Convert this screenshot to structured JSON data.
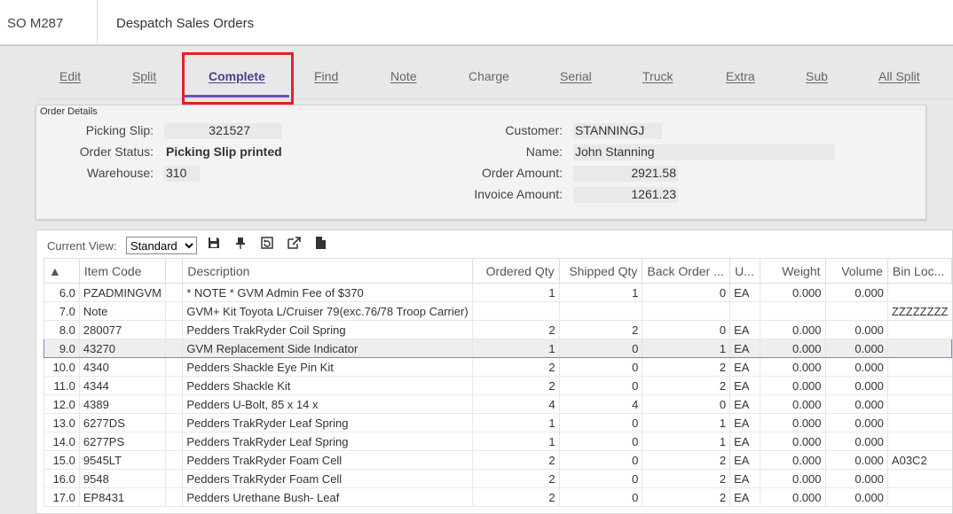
{
  "header": {
    "code": "SO M287",
    "title": "Despatch Sales Orders"
  },
  "tabs": [
    {
      "label": "Edit",
      "name": "tab-edit"
    },
    {
      "label": "Split",
      "name": "tab-split"
    },
    {
      "label": "Complete",
      "name": "tab-complete",
      "active": true
    },
    {
      "label": "Find",
      "name": "tab-find"
    },
    {
      "label": "Note",
      "name": "tab-note"
    },
    {
      "label": "Charge",
      "name": "tab-charge"
    },
    {
      "label": "Serial",
      "name": "tab-serial"
    },
    {
      "label": "Truck",
      "name": "tab-truck"
    },
    {
      "label": "Extra",
      "name": "tab-extra"
    },
    {
      "label": "Sub",
      "name": "tab-sub"
    },
    {
      "label": "All Split",
      "name": "tab-all-split"
    }
  ],
  "details": {
    "legend": "Order Details",
    "picking_slip_label": "Picking Slip:",
    "picking_slip": "321527",
    "order_status_label": "Order Status:",
    "order_status": "Picking Slip printed",
    "warehouse_label": "Warehouse:",
    "warehouse": "310",
    "customer_label": "Customer:",
    "customer": "STANNINGJ",
    "name_label": "Name:",
    "name": "John Stanning",
    "order_amount_label": "Order Amount:",
    "order_amount": "2921.58",
    "invoice_amount_label": "Invoice Amount:",
    "invoice_amount": "1261.23"
  },
  "grid": {
    "current_view_label": "Current View:",
    "current_view": "Standard",
    "columns": [
      "▲",
      "Item Code",
      "",
      "Description",
      "Ordered Qty",
      "Shipped Qty",
      "Back Order ...",
      "U...",
      "Weight",
      "Volume",
      "Bin Loc..."
    ],
    "rows": [
      [
        "6.0",
        "PZADMINGVM",
        "",
        "* NOTE * GVM Admin Fee of $370",
        "1",
        "1",
        "0",
        "EA",
        "0.000",
        "0.000",
        ""
      ],
      [
        "7.0",
        "Note",
        "",
        "GVM+ Kit Toyota L/Cruiser 79(exc.76/78 Troop Carrier)",
        "",
        "",
        "",
        "",
        "",
        "",
        "ZZZZZZZZ"
      ],
      [
        "8.0",
        "280077",
        "",
        "Pedders TrakRyder Coil Spring",
        "2",
        "2",
        "0",
        "EA",
        "0.000",
        "0.000",
        ""
      ],
      [
        "9.0",
        "43270",
        "",
        "GVM Replacement Side Indicator",
        "1",
        "0",
        "1",
        "EA",
        "0.000",
        "0.000",
        ""
      ],
      [
        "10.0",
        "4340",
        "",
        "Pedders Shackle Eye Pin Kit",
        "2",
        "0",
        "2",
        "EA",
        "0.000",
        "0.000",
        ""
      ],
      [
        "11.0",
        "4344",
        "",
        "Pedders Shackle Kit",
        "2",
        "0",
        "2",
        "EA",
        "0.000",
        "0.000",
        ""
      ],
      [
        "12.0",
        "4389",
        "",
        "Pedders U-Bolt, 85 x 14 x",
        "4",
        "4",
        "0",
        "EA",
        "0.000",
        "0.000",
        ""
      ],
      [
        "13.0",
        "6277DS",
        "",
        "Pedders TrakRyder Leaf Spring",
        "1",
        "0",
        "1",
        "EA",
        "0.000",
        "0.000",
        ""
      ],
      [
        "14.0",
        "6277PS",
        "",
        "Pedders TrakRyder Leaf Spring",
        "1",
        "0",
        "1",
        "EA",
        "0.000",
        "0.000",
        ""
      ],
      [
        "15.0",
        "9545LT",
        "",
        "Pedders TrakRyder Foam Cell",
        "2",
        "0",
        "2",
        "EA",
        "0.000",
        "0.000",
        "A03C2"
      ],
      [
        "16.0",
        "9548",
        "",
        "Pedders TrakRyder Foam Cell",
        "2",
        "0",
        "2",
        "EA",
        "0.000",
        "0.000",
        ""
      ],
      [
        "17.0",
        "EP8431",
        "",
        "Pedders Urethane Bush- Leaf",
        "2",
        "0",
        "2",
        "EA",
        "0.000",
        "0.000",
        ""
      ]
    ],
    "selected_row": 3
  },
  "colors": {
    "accent": "#6b4fc8",
    "highlight": "#e8202a"
  }
}
